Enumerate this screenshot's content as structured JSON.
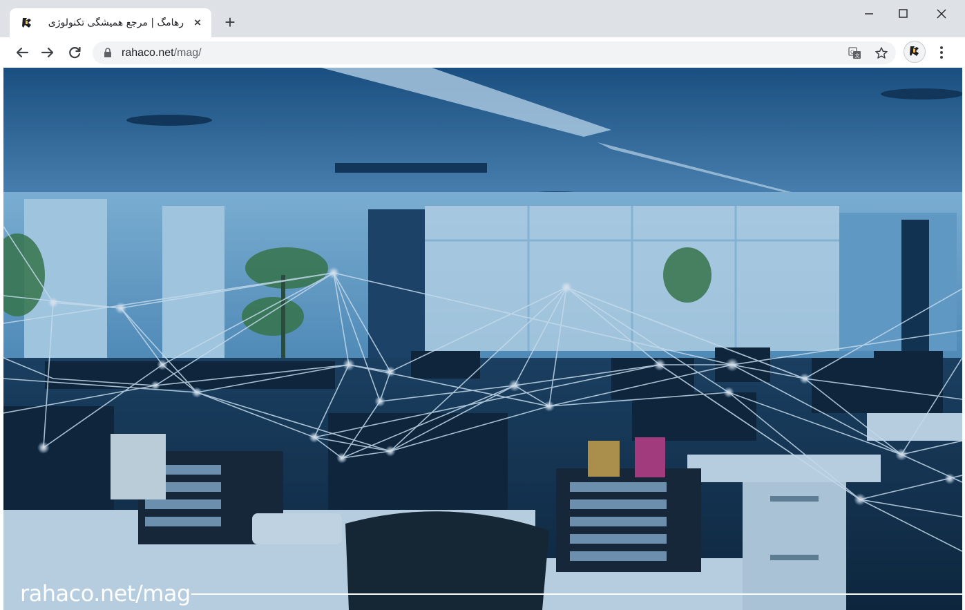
{
  "browser": {
    "tab": {
      "title": "رهامگ | مرجع همیشگی تکنولوژی |",
      "close_label": "×",
      "favicon": "rahaco-logo-icon"
    },
    "new_tab_label": "+",
    "window_controls": {
      "minimize": "–",
      "maximize": "☐",
      "close": "✕"
    },
    "address_bar": {
      "domain": "rahaco.net",
      "path": "/mag/"
    },
    "icons": {
      "back": "back-arrow-icon",
      "forward": "forward-arrow-icon",
      "reload": "reload-icon",
      "lock": "lock-icon",
      "translate": "translate-icon",
      "bookmark": "star-icon",
      "profile": "profile-avatar-icon",
      "menu": "three-dots-menu-icon"
    }
  },
  "page": {
    "caption": "rahaco.net/mag",
    "image_subject": "office-network-hero-image"
  },
  "colors": {
    "tab_strip": "#dee1e6",
    "omnibox": "#f1f3f4",
    "hero_tint": "#1d5a8f"
  }
}
